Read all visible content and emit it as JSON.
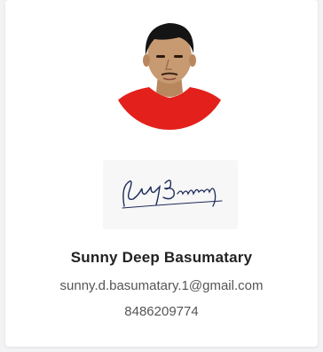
{
  "profile": {
    "name": "Sunny Deep Basumatary",
    "email": "sunny.d.basumatary.1@gmail.com",
    "phone": "8486209774"
  },
  "images": {
    "avatar_icon": "profile-photo",
    "signature_icon": "signature-image"
  },
  "colors": {
    "shirt": "#e3201b",
    "skin": "#c89a72",
    "hair": "#141414",
    "ink": "#1e2a5a"
  }
}
